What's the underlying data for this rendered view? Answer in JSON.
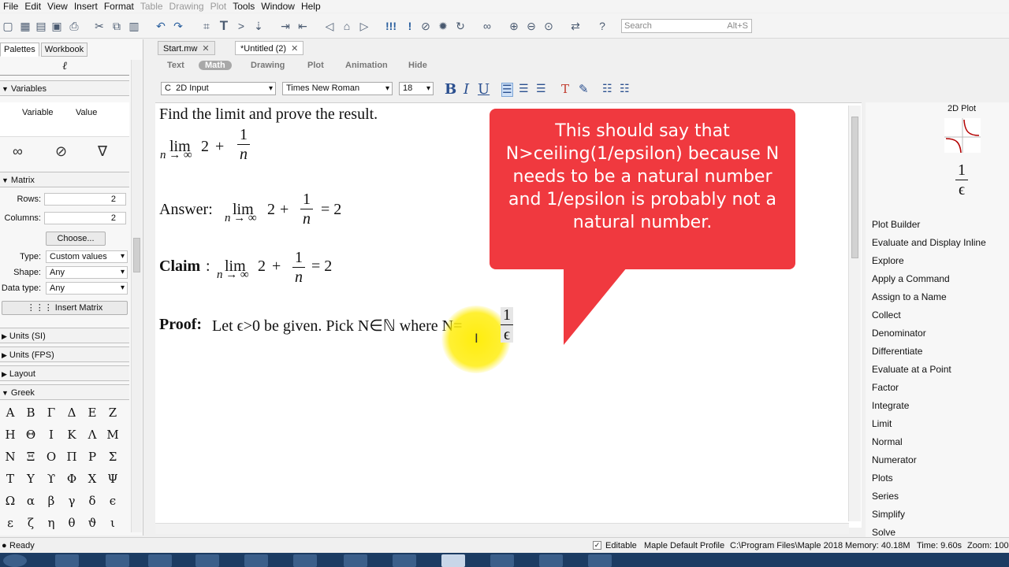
{
  "menubar": [
    "File",
    "Edit",
    "View",
    "Insert",
    "Format",
    "Table",
    "Drawing",
    "Plot",
    "Tools",
    "Window",
    "Help"
  ],
  "menubar_disabled": [
    "Table",
    "Drawing",
    "Plot"
  ],
  "search": {
    "placeholder": "Search",
    "hint": "Alt+S"
  },
  "palette_tabs": [
    "Palettes",
    "Workbook"
  ],
  "variables": {
    "header": "Variables",
    "col_variable": "Variable",
    "col_value": "Value"
  },
  "matrix": {
    "header": "Matrix",
    "rows_label": "Rows:",
    "rows_value": "2",
    "columns_label": "Columns:",
    "columns_value": "2",
    "choose_label": "Choose...",
    "type_label": "Type:",
    "type_value": "Custom values",
    "shape_label": "Shape:",
    "shape_value": "Any",
    "datatype_label": "Data type:",
    "datatype_value": "Any",
    "insert_label": "Insert Matrix"
  },
  "palette_sections": [
    "Units (SI)",
    "Units (FPS)",
    "Layout",
    "Greek"
  ],
  "greek_rows": [
    [
      "Α",
      "Β",
      "Γ",
      "Δ",
      "Ε",
      "Ζ"
    ],
    [
      "Η",
      "Θ",
      "Ι",
      "Κ",
      "Λ",
      "Μ"
    ],
    [
      "Ν",
      "Ξ",
      "Ο",
      "Π",
      "Ρ",
      "Σ"
    ],
    [
      "Τ",
      "Υ",
      "ϒ",
      "Φ",
      "Χ",
      "Ψ"
    ],
    [
      "Ω",
      "α",
      "β",
      "γ",
      "δ",
      "ϵ"
    ],
    [
      "ε",
      "ζ",
      "η",
      "θ",
      "ϑ",
      "ι"
    ]
  ],
  "doc_tabs": [
    {
      "label": "Start.mw",
      "active": false
    },
    {
      "label": "*Untitled (2)",
      "active": true
    }
  ],
  "modes": [
    "Text",
    "Math",
    "Drawing",
    "Plot",
    "Animation",
    "Hide"
  ],
  "active_mode": "Math",
  "format": {
    "input_mode": "2D Input",
    "input_prefix": "C",
    "font": "Times New Roman",
    "size": "18"
  },
  "document": {
    "line1": "Find the limit and prove the result.",
    "lim_word": "lim",
    "lim_sub": "n → ∞",
    "two": "2",
    "plus": "+",
    "one": "1",
    "n": "n",
    "equals_two": "= 2",
    "answer_label": "Answer:",
    "claim_label": "Claim",
    "claim_colon": ":",
    "proof_label": "Proof:",
    "proof_text": "Let ϵ>0 be given. Pick N∈ℕ where N=",
    "proof_num": "1",
    "proof_den": "ϵ"
  },
  "callout": {
    "text": "This should say that N>ceiling(1/epsilon) because N needs to be a natural number and 1/epsilon is probably not a natural number.",
    "color": "#f0393f"
  },
  "context_panel": {
    "plot_caption": "2D Plot",
    "preview_num": "1",
    "preview_den": "ϵ",
    "items": [
      "Plot Builder",
      "Evaluate and Display Inline",
      "Explore",
      "Apply a Command",
      "Assign to a Name",
      "Collect",
      "Denominator",
      "Differentiate",
      "Evaluate at a Point",
      "Factor",
      "Integrate",
      "Limit",
      "Normal",
      "Numerator",
      "Plots",
      "Series",
      "Simplify",
      "Solve"
    ]
  },
  "status": {
    "ready": "Ready",
    "editable": "Editable",
    "profile": "Maple Default Profile",
    "path": "C:\\Program Files\\Maple 2018",
    "memory": "Memory: 40.18M",
    "time": "Time: 9.60s",
    "zoom": "Zoom: 100"
  }
}
